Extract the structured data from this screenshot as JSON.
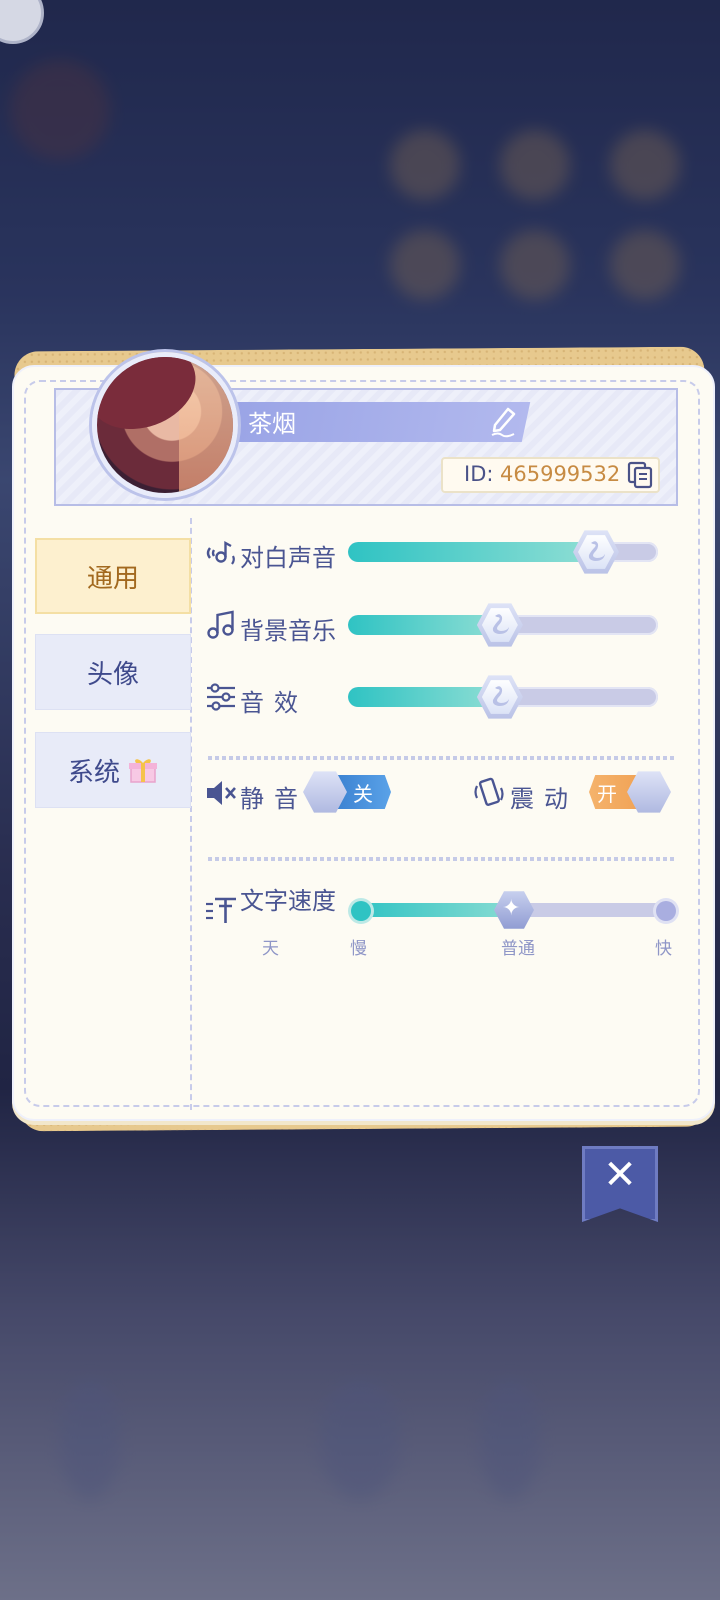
{
  "profile": {
    "name": "茶烟",
    "id_label": "ID:",
    "id_value": "465999532"
  },
  "tabs": [
    {
      "label": "通用",
      "active": true
    },
    {
      "label": "头像",
      "active": false
    },
    {
      "label": "系统",
      "active": false,
      "icon": "gift-icon"
    }
  ],
  "settings": {
    "dialogue_voice": {
      "label": "对白声音",
      "icon": "voice-icon",
      "level": 0.8
    },
    "bgm": {
      "label": "背景音乐",
      "icon": "music-note-icon",
      "level": 0.49
    },
    "sfx": {
      "label": "音效",
      "icon": "equalizer-icon",
      "level": 0.49
    },
    "mute": {
      "label": "静音",
      "icon": "speaker-muted-icon",
      "state_label": "关",
      "on": false
    },
    "vibration": {
      "label": "震动",
      "icon": "phone-vibrate-icon",
      "state_label": "开",
      "on": true
    },
    "text_speed": {
      "label": "文字速度",
      "icon": "text-speed-icon",
      "ticks": [
        "天",
        "慢",
        "普通",
        "快"
      ],
      "level": 0.5
    }
  },
  "colors": {
    "accent_teal": "#2fc3c3",
    "primary_blue": "#4a5592",
    "toggle_off": "#3c86d6",
    "toggle_on": "#f2a55a",
    "id_orange": "#c78b43"
  }
}
